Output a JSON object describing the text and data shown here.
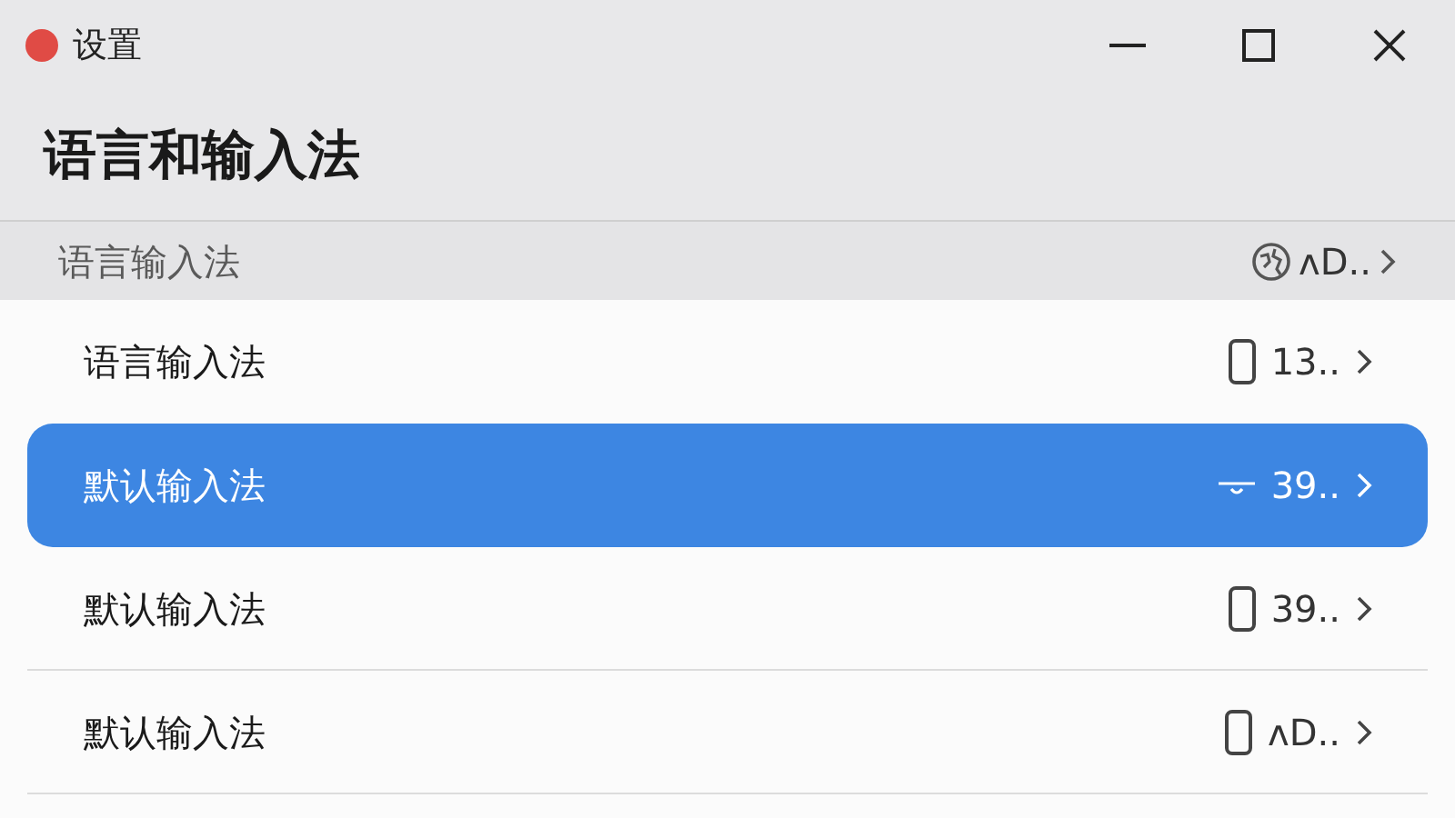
{
  "window": {
    "title": "设置"
  },
  "heading": "语言和输入法",
  "section": {
    "label": "语言输入法",
    "kind": "globe",
    "value": "ᴧD.."
  },
  "rows": [
    {
      "label": "语言输入法",
      "kind": "phone",
      "value": "13..",
      "selected": false
    },
    {
      "label": "默认输入法",
      "kind": "bar",
      "value": "39..",
      "selected": true
    },
    {
      "label": "默认输入法",
      "kind": "phone",
      "value": "39..",
      "selected": false
    },
    {
      "label": "默认输入法",
      "kind": "phone",
      "value": "ᴧD..",
      "selected": false
    }
  ]
}
